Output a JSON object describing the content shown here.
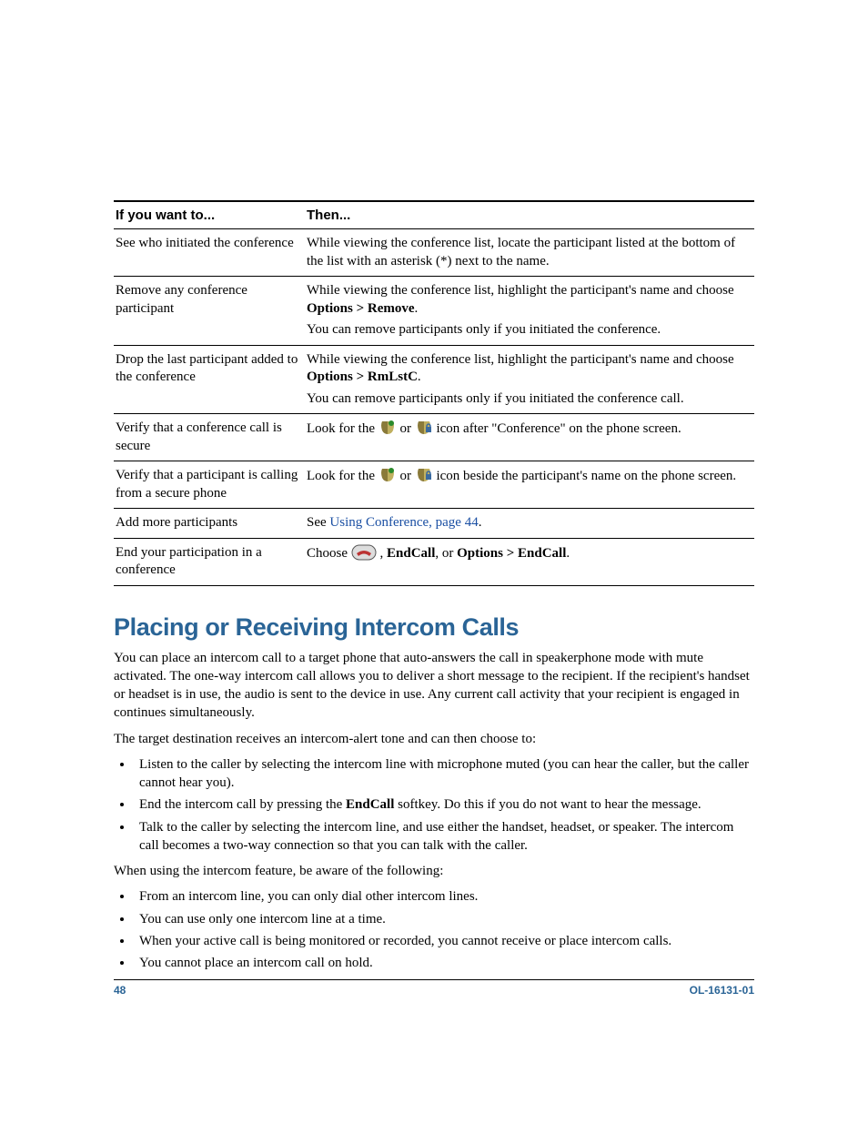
{
  "table": {
    "headers": [
      "If you want to...",
      "Then..."
    ],
    "rows": [
      {
        "want": "See who initiated the conference",
        "then": [
          "While viewing the conference list, locate the participant listed at the bottom of the list with an asterisk (*) next to the name."
        ]
      },
      {
        "want": "Remove any conference participant",
        "then_p1_pre": "While viewing the conference list, highlight the participant's name and choose ",
        "then_p1_bold": "Options > Remove",
        "then_p1_post": ".",
        "then_p2": "You can remove participants only if you initiated the conference."
      },
      {
        "want": "Drop the last participant added to the conference",
        "then_p1_pre": "While viewing the conference list, highlight the participant's name and choose ",
        "then_p1_bold": "Options > RmLstC",
        "then_p1_post": ".",
        "then_p2": "You can remove participants only if you initiated the conference call."
      },
      {
        "want": "Verify that a conference call is secure",
        "then_pre": "Look for the ",
        "then_mid": " or ",
        "then_post": " icon after \"Conference\" on the phone screen."
      },
      {
        "want": "Verify that a participant is calling from a secure phone",
        "then_pre": "Look for the ",
        "then_mid": " or ",
        "then_post": " icon beside the participant's name on the phone screen."
      },
      {
        "want": "Add more participants",
        "then_pre": "See ",
        "then_link": "Using Conference, page 44",
        "then_post": "."
      },
      {
        "want": "End your participation in a conference",
        "then_pre": "Choose ",
        "then_mid1": ", ",
        "then_bold1": "EndCall",
        "then_mid2": ", or ",
        "then_bold2": "Options > EndCall",
        "then_post": "."
      }
    ]
  },
  "section": {
    "heading": "Placing or Receiving Intercom Calls",
    "para1": "You can place an intercom call to a target phone that auto-answers the call in speakerphone mode with mute activated. The one-way intercom call allows you to deliver a short message to the recipient. If the recipient's handset or headset is in use, the audio is sent to the device in use. Any current call activity that your recipient is engaged in continues simultaneously.",
    "para2": "The target destination receives an intercom-alert tone and can then choose to:",
    "list1": [
      "Listen to the caller by selecting the intercom line with microphone muted (you can hear the caller, but the caller cannot hear you).",
      "",
      "Talk to the caller by selecting the intercom line, and use either the handset, headset, or speaker. The intercom call becomes a two-way connection so that you can talk with the caller."
    ],
    "list1_item2_pre": "End the intercom call by pressing the ",
    "list1_item2_bold": "EndCall",
    "list1_item2_post": " softkey. Do this if you do not want to hear the message.",
    "para3": "When using the intercom feature, be aware of the following:",
    "list2": [
      "From an intercom line, you can only dial other intercom lines.",
      "You can use only one intercom line at a time.",
      "When your active call is being monitored or recorded, you cannot receive or place intercom calls.",
      "You cannot place an intercom call on hold."
    ]
  },
  "footer": {
    "page": "48",
    "docid": "OL-16131-01"
  }
}
